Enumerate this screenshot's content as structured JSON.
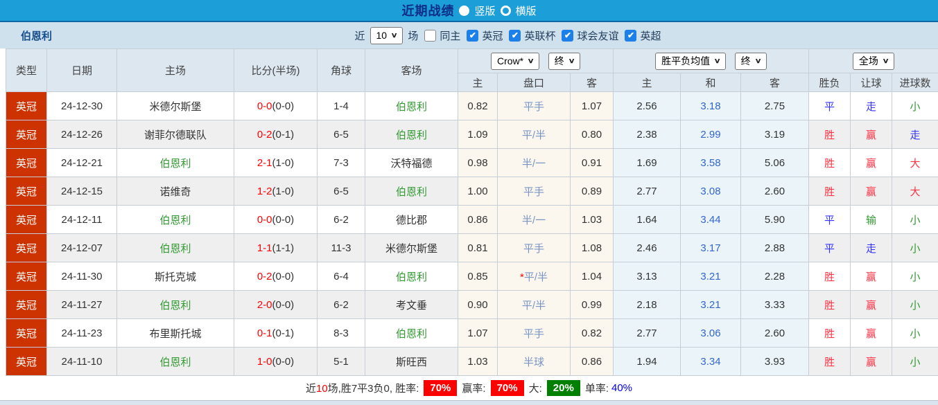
{
  "header": {
    "title": "近期战绩",
    "vertical_label": "竖版",
    "horizontal_label": "横版"
  },
  "filter": {
    "team": "伯恩利",
    "recent_label": "近",
    "recent_value": "10",
    "games_label": "场",
    "same_home_label": "同主",
    "leagues": [
      {
        "label": "英冠",
        "checked": true
      },
      {
        "label": "英联杯",
        "checked": true
      },
      {
        "label": "球会友谊",
        "checked": true
      },
      {
        "label": "英超",
        "checked": true
      }
    ]
  },
  "table": {
    "static_headers": [
      "类型",
      "日期",
      "主场",
      "比分(半场)",
      "角球",
      "客场"
    ],
    "odds_group": {
      "bookmaker": "Crow*",
      "time": "终",
      "cols": [
        "主",
        "盘口",
        "客"
      ]
    },
    "avg_group": {
      "name": "胜平负均值",
      "time": "终",
      "cols": [
        "主",
        "和",
        "客"
      ]
    },
    "result_group": {
      "scope": "全场",
      "cols": [
        "胜负",
        "让球",
        "进球数"
      ]
    },
    "rows": [
      {
        "type": "英冠",
        "date": "24-12-30",
        "home": "米德尔斯堡",
        "home_green": false,
        "score": "0-0",
        "half": "(0-0)",
        "corner": "1-4",
        "away": "伯恩利",
        "away_green": true,
        "crow_home": "0.82",
        "handicap": "平手",
        "handicap_star": false,
        "crow_away": "1.07",
        "avg_home": "2.56",
        "avg_draw": "3.18",
        "avg_away": "2.75",
        "spf": {
          "t": "平",
          "c": "blue"
        },
        "rq": {
          "t": "走",
          "c": "blue"
        },
        "jq": {
          "t": "小",
          "c": "green"
        }
      },
      {
        "type": "英冠",
        "date": "24-12-26",
        "home": "谢菲尔德联队",
        "home_green": false,
        "score": "0-2",
        "half": "(0-1)",
        "corner": "6-5",
        "away": "伯恩利",
        "away_green": true,
        "crow_home": "1.09",
        "handicap": "平/半",
        "handicap_star": false,
        "crow_away": "0.80",
        "avg_home": "2.38",
        "avg_draw": "2.99",
        "avg_away": "3.19",
        "spf": {
          "t": "胜",
          "c": "red"
        },
        "rq": {
          "t": "赢",
          "c": "red"
        },
        "jq": {
          "t": "走",
          "c": "blue"
        }
      },
      {
        "type": "英冠",
        "date": "24-12-21",
        "home": "伯恩利",
        "home_green": true,
        "score": "2-1",
        "half": "(1-0)",
        "corner": "7-3",
        "away": "沃特福德",
        "away_green": false,
        "crow_home": "0.98",
        "handicap": "半/一",
        "handicap_star": false,
        "crow_away": "0.91",
        "avg_home": "1.69",
        "avg_draw": "3.58",
        "avg_away": "5.06",
        "spf": {
          "t": "胜",
          "c": "red"
        },
        "rq": {
          "t": "赢",
          "c": "red"
        },
        "jq": {
          "t": "大",
          "c": "red"
        }
      },
      {
        "type": "英冠",
        "date": "24-12-15",
        "home": "诺维奇",
        "home_green": false,
        "score": "1-2",
        "half": "(1-0)",
        "corner": "6-5",
        "away": "伯恩利",
        "away_green": true,
        "crow_home": "1.00",
        "handicap": "平手",
        "handicap_star": false,
        "crow_away": "0.89",
        "avg_home": "2.77",
        "avg_draw": "3.08",
        "avg_away": "2.60",
        "spf": {
          "t": "胜",
          "c": "red"
        },
        "rq": {
          "t": "赢",
          "c": "red"
        },
        "jq": {
          "t": "大",
          "c": "red"
        }
      },
      {
        "type": "英冠",
        "date": "24-12-11",
        "home": "伯恩利",
        "home_green": true,
        "score": "0-0",
        "half": "(0-0)",
        "corner": "6-2",
        "away": "德比郡",
        "away_green": false,
        "crow_home": "0.86",
        "handicap": "半/一",
        "handicap_star": false,
        "crow_away": "1.03",
        "avg_home": "1.64",
        "avg_draw": "3.44",
        "avg_away": "5.90",
        "spf": {
          "t": "平",
          "c": "blue"
        },
        "rq": {
          "t": "输",
          "c": "green"
        },
        "jq": {
          "t": "小",
          "c": "green"
        }
      },
      {
        "type": "英冠",
        "date": "24-12-07",
        "home": "伯恩利",
        "home_green": true,
        "score": "1-1",
        "half": "(1-1)",
        "corner": "11-3",
        "away": "米德尔斯堡",
        "away_green": false,
        "crow_home": "0.81",
        "handicap": "平手",
        "handicap_star": false,
        "crow_away": "1.08",
        "avg_home": "2.46",
        "avg_draw": "3.17",
        "avg_away": "2.88",
        "spf": {
          "t": "平",
          "c": "blue"
        },
        "rq": {
          "t": "走",
          "c": "blue"
        },
        "jq": {
          "t": "小",
          "c": "green"
        }
      },
      {
        "type": "英冠",
        "date": "24-11-30",
        "home": "斯托克城",
        "home_green": false,
        "score": "0-2",
        "half": "(0-0)",
        "corner": "6-4",
        "away": "伯恩利",
        "away_green": true,
        "crow_home": "0.85",
        "handicap": "平/半",
        "handicap_star": true,
        "crow_away": "1.04",
        "avg_home": "3.13",
        "avg_draw": "3.21",
        "avg_away": "2.28",
        "spf": {
          "t": "胜",
          "c": "red"
        },
        "rq": {
          "t": "赢",
          "c": "red"
        },
        "jq": {
          "t": "小",
          "c": "green"
        }
      },
      {
        "type": "英冠",
        "date": "24-11-27",
        "home": "伯恩利",
        "home_green": true,
        "score": "2-0",
        "half": "(0-0)",
        "corner": "6-2",
        "away": "考文垂",
        "away_green": false,
        "crow_home": "0.90",
        "handicap": "平/半",
        "handicap_star": false,
        "crow_away": "0.99",
        "avg_home": "2.18",
        "avg_draw": "3.21",
        "avg_away": "3.33",
        "spf": {
          "t": "胜",
          "c": "red"
        },
        "rq": {
          "t": "赢",
          "c": "red"
        },
        "jq": {
          "t": "小",
          "c": "green"
        }
      },
      {
        "type": "英冠",
        "date": "24-11-23",
        "home": "布里斯托城",
        "home_green": false,
        "score": "0-1",
        "half": "(0-1)",
        "corner": "8-3",
        "away": "伯恩利",
        "away_green": true,
        "crow_home": "1.07",
        "handicap": "平手",
        "handicap_star": false,
        "crow_away": "0.82",
        "avg_home": "2.77",
        "avg_draw": "3.06",
        "avg_away": "2.60",
        "spf": {
          "t": "胜",
          "c": "red"
        },
        "rq": {
          "t": "赢",
          "c": "red"
        },
        "jq": {
          "t": "小",
          "c": "green"
        }
      },
      {
        "type": "英冠",
        "date": "24-11-10",
        "home": "伯恩利",
        "home_green": true,
        "score": "1-0",
        "half": "(0-0)",
        "corner": "5-1",
        "away": "斯旺西",
        "away_green": false,
        "crow_home": "1.03",
        "handicap": "半球",
        "handicap_star": false,
        "crow_away": "0.86",
        "avg_home": "1.94",
        "avg_draw": "3.34",
        "avg_away": "3.93",
        "spf": {
          "t": "胜",
          "c": "red"
        },
        "rq": {
          "t": "赢",
          "c": "red"
        },
        "jq": {
          "t": "小",
          "c": "green"
        }
      }
    ]
  },
  "footer": {
    "prefix_1": "近",
    "count": "10",
    "prefix_2": "场,胜7平3负0, 胜率:",
    "win_rate": "70%",
    "label_yinglv": "赢率:",
    "ying_rate": "70%",
    "label_da": "大:",
    "da_rate": "20%",
    "label_dan": "单率:",
    "dan_rate": "40%"
  },
  "icons": {
    "check": "✔",
    "chevron": "∨"
  },
  "colors": {
    "topbar_blue": "#1c9ed9",
    "league_red": "#cc3300",
    "checkbox_blue": "#1d80e8",
    "win_red": "#ff3344",
    "draw_blue": "#3333ff",
    "green": "#339933",
    "badge_red": "#ff0000",
    "badge_green": "#008000"
  }
}
